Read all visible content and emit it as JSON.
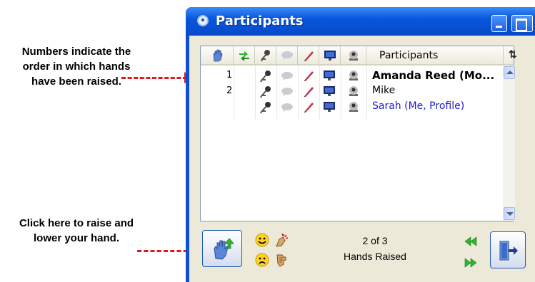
{
  "annotations": {
    "hand_order": "Numbers indicate the order in which hands have been raised.",
    "raise_hand": "Click here to raise and lower your hand."
  },
  "window": {
    "title": "Participants",
    "title_icon": "participants-icon"
  },
  "list": {
    "header_label": "Participants",
    "header_sort_symbol": "⇅",
    "header_icons": [
      "raised-hand-icon",
      "transfer-arrows-icon",
      "microphone-icon",
      "chat-bubble-icon",
      "pencil-icon",
      "monitor-icon",
      "webcam-icon"
    ],
    "rows": [
      {
        "order": "1",
        "name": "Amanda Reed (Mo...",
        "bold": true,
        "color": "#000000"
      },
      {
        "order": "2",
        "name": "Mike",
        "bold": false,
        "color": "#000000"
      },
      {
        "order": "",
        "name": "Sarah (Me, Profile)",
        "bold": false,
        "color": "#1a1ad6"
      }
    ]
  },
  "status": {
    "count": "2 of 3",
    "label": "Hands Raised"
  },
  "colors": {
    "accent_blue": "#0a4fd6",
    "callout_red": "#e8141b",
    "arrow_green": "#2db52d"
  },
  "icons": {
    "raise_hand_button": "raise-hand-button-icon",
    "smiley": "smiley-icon",
    "sad": "sad-icon",
    "applause": "applause-icon",
    "hand_gesture": "hand-gesture-icon",
    "exit": "exit-door-icon"
  }
}
